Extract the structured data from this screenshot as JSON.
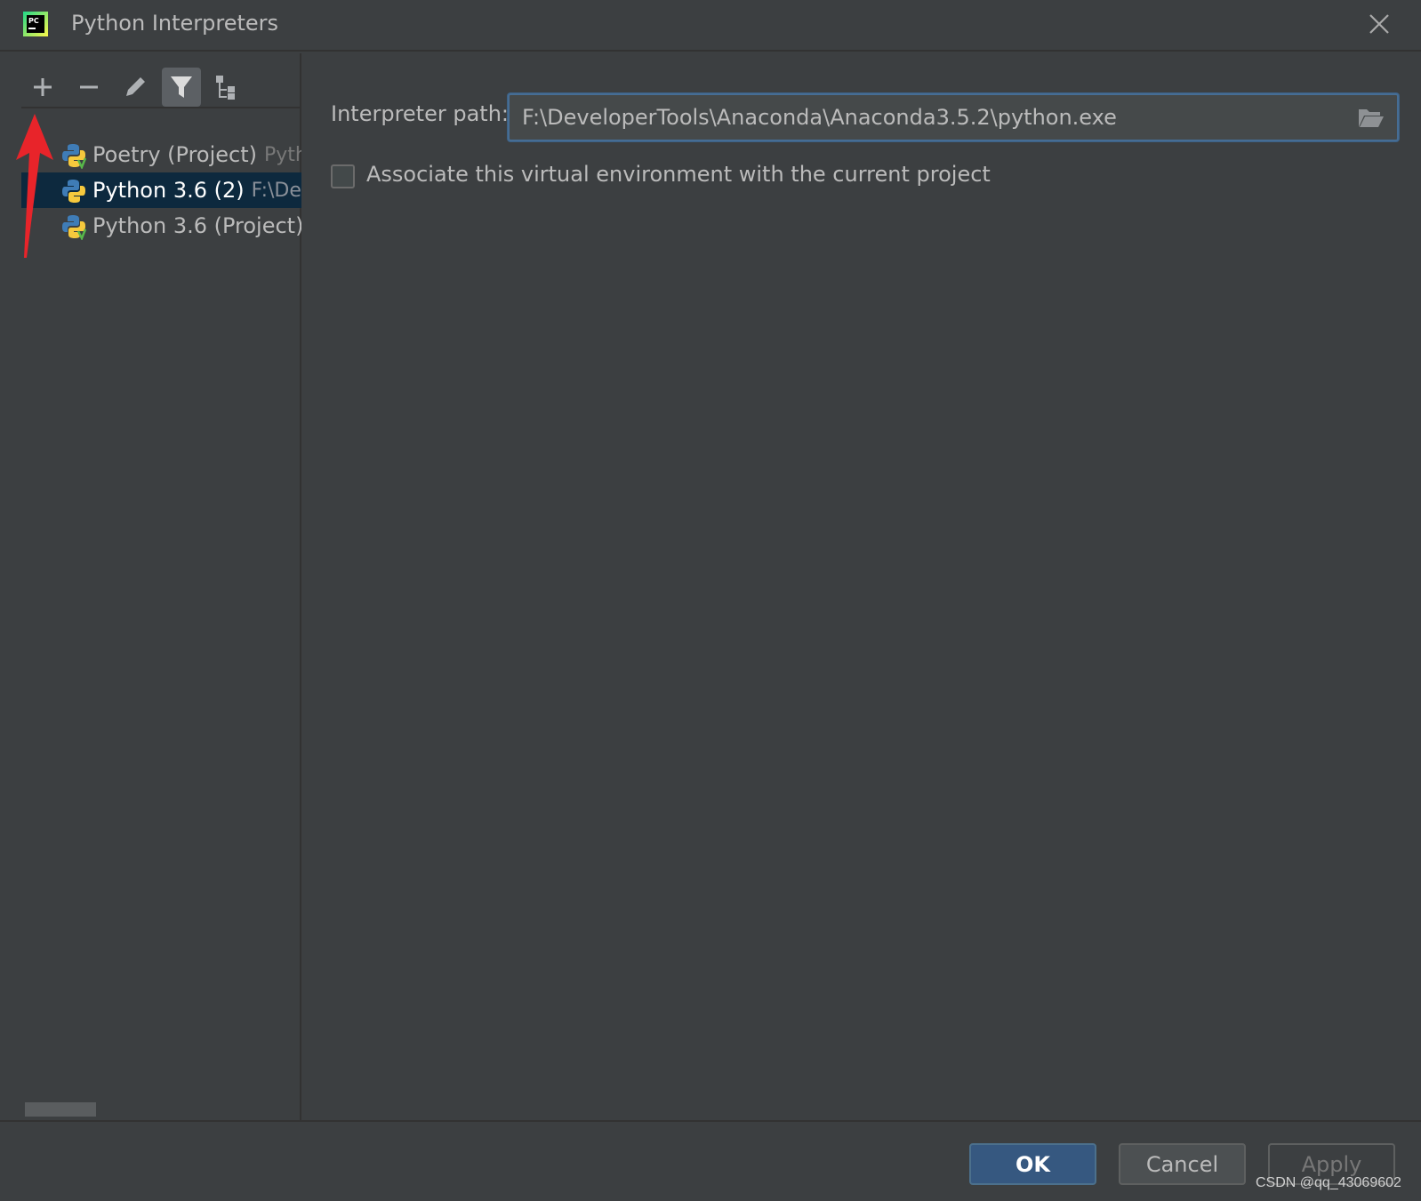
{
  "window": {
    "title": "Python Interpreters",
    "app_icon": "pycharm-logo",
    "close_icon": "close-icon"
  },
  "toolbar": {
    "buttons": [
      {
        "icon": "add-icon"
      },
      {
        "icon": "remove-icon"
      },
      {
        "icon": "edit-icon"
      },
      {
        "icon": "filter-icon",
        "active": true
      },
      {
        "icon": "tree-view-icon"
      }
    ]
  },
  "interpreters": [
    {
      "name": "Poetry (Project)",
      "path": "Pyth",
      "selected": false
    },
    {
      "name": "Python 3.6 (2)",
      "path": "F:\\Dev",
      "selected": true
    },
    {
      "name": "Python 3.6 (Project)",
      "path": "",
      "selected": false
    }
  ],
  "details": {
    "path_label": "Interpreter path:",
    "path_value": "F:\\DeveloperTools\\Anaconda\\Anaconda3.5.2\\python.exe",
    "associate_label": "Associate this virtual environment with the current project",
    "associate_checked": false
  },
  "footer": {
    "ok_label": "OK",
    "cancel_label": "Cancel",
    "apply_label": "Apply"
  },
  "watermark": "CSDN @qq_43069602",
  "colors": {
    "background": "#3c3f41",
    "selection": "#0d293e",
    "primary_button": "#365880",
    "annotation_arrow": "#e8242a"
  }
}
